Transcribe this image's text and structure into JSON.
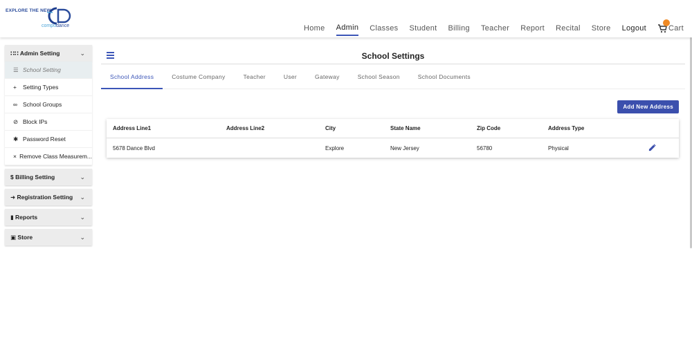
{
  "brand": {
    "tagline": "EXPLORE THE NEW",
    "sub_prefix": "compu",
    "sub_suffix": "dance",
    "accent": "#3b55b7",
    "orange": "#f08a24"
  },
  "nav": {
    "items": [
      "Home",
      "Admin",
      "Classes",
      "Student",
      "Billing",
      "Teacher",
      "Report",
      "Recital",
      "Store"
    ],
    "active": "Admin",
    "logout": "Logout",
    "cart": "Cart"
  },
  "sidebar": {
    "admin_setting": "Admin Setting",
    "admin_items": [
      {
        "icon": "list-icon",
        "label": "School Setting"
      },
      {
        "icon": "plus-icon",
        "label": "Setting Types"
      },
      {
        "icon": "link-icon",
        "label": "School Groups"
      },
      {
        "icon": "block-icon",
        "label": "Block IPs"
      },
      {
        "icon": "gear-icon",
        "label": "Password Reset"
      },
      {
        "icon": "close-icon",
        "label": "Remove Class Measurem..."
      }
    ],
    "billing_setting": "Billing Setting",
    "registration_setting": "Registration Setting",
    "reports": "Reports",
    "store": "Store"
  },
  "main": {
    "title": "School Settings",
    "tabs": [
      "School Address",
      "Costume Company",
      "Teacher",
      "User",
      "Gateway",
      "School Season",
      "School Documents"
    ],
    "active_tab": "School Address",
    "add_button": "Add New Address",
    "table": {
      "headers": [
        "Address Line1",
        "Address Line2",
        "City",
        "State Name",
        "Zip Code",
        "Address Type"
      ],
      "rows": [
        [
          "5678 Dance Blvd",
          "",
          "Explore",
          "New Jersey",
          "56780",
          "Physical"
        ]
      ]
    }
  }
}
